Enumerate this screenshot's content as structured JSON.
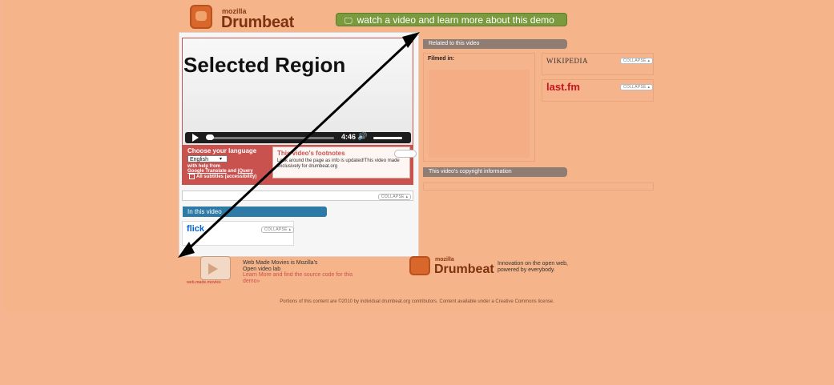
{
  "header": {
    "brand_small": "mozilla",
    "brand_big": "Drumbeat",
    "watch_button": "watch a video and learn more about this demo"
  },
  "video": {
    "overlay_label": "Selected Region",
    "time": "4:46"
  },
  "language": {
    "title": "Choose your language",
    "selected": "English",
    "help_prefix": "with help from",
    "help_link_1": "Google Translate",
    "help_and": "and",
    "help_link_2": "jQuery",
    "all_subtitles": "All subtitles (accessibility)"
  },
  "footnotes": {
    "title": "This video's footnotes",
    "body": "Look around the page as info is updated!This video made exclusively for drumbeat.org"
  },
  "panels": {
    "collapse_label": "COLLAPSE ▴",
    "in_this_video": "In this video",
    "flickr_label": "flick",
    "related": "Related to this video",
    "filmed_in": "Filmed in:",
    "wikipedia": "WIKIPEDIA",
    "lastfm": "last.fm",
    "copyright_info": "This video's copyright information"
  },
  "footer": {
    "wmm_logo_text": "web.made.movies",
    "wmm_line1": "Web Made Movies is Mozilla's",
    "wmm_line2": "Open video lab",
    "wmm_link": "Learn More and find the source code for this demo»",
    "drumbeat_small": "mozilla",
    "drumbeat_big": "Drumbeat",
    "tagline": "Innovation on the open web, powered by everybody.",
    "copyright": "Portions of this content are ©2010 by individual drumbeat.org contributors. Content available under a Creative Commons license."
  },
  "colors": {
    "background": "#f6b48a",
    "accent_red": "#c9524f",
    "accent_green": "#7a9a3e",
    "accent_blue": "#2d7aa6"
  }
}
